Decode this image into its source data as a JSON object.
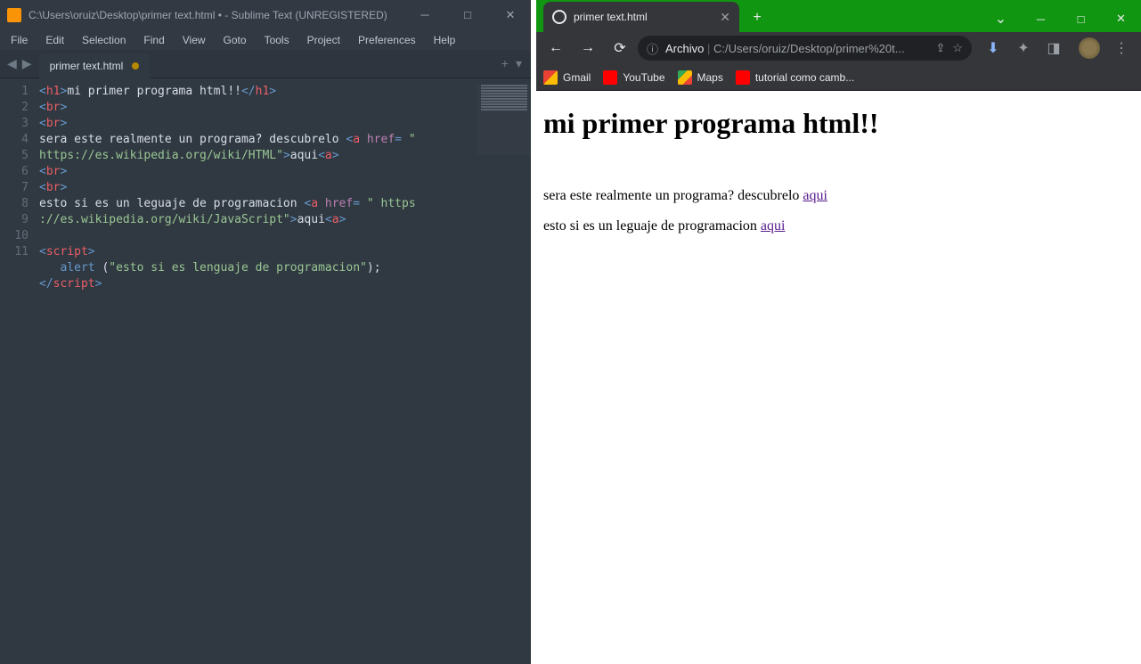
{
  "sublime": {
    "title": "C:\\Users\\oruiz\\Desktop\\primer text.html • - Sublime Text (UNREGISTERED)",
    "menu": [
      "File",
      "Edit",
      "Selection",
      "Find",
      "View",
      "Goto",
      "Tools",
      "Project",
      "Preferences",
      "Help"
    ],
    "tab": "primer text.html",
    "tab_modified": true,
    "line_numbers": [
      "1",
      "2",
      "3",
      "4",
      "",
      "5",
      "6",
      "7",
      "",
      "8",
      "9",
      "10",
      "11"
    ],
    "code": {
      "l1_tag_open": "<h1>",
      "l1_text": "mi primer programa html!!",
      "l1_tag_close": "</h1>",
      "l2": "<br>",
      "l3": "<br>",
      "l4_text": "sera este realmente un programa? descubrelo ",
      "l4_a_open": "<a",
      "l4_href_attr": " href",
      "l4_eq": "= ",
      "l4_href_val": "\" https://es.wikipedia.org/wiki/HTML\"",
      "l4_close": ">",
      "l4b_text": "aqui",
      "l4b_ac": "<a>",
      "l5": "<br>",
      "l6": "<br>",
      "l7_text": "esto si es un leguaje de programacion ",
      "l7_a_open": "<a",
      "l7_href_attr": " href",
      "l7_eq": "= ",
      "l7_href_val": "\" https://es.wikipedia.org/wiki/JavaScript\"",
      "l7_close": ">",
      "l7b_text": "aqui",
      "l7b_ac": "<a>",
      "l9_open": "<script",
      "l9_close": ">",
      "l10_indent": "   ",
      "l10_fn": "alert ",
      "l10_p1": "(",
      "l10_str": "\"esto si es lenguaje de programacion\"",
      "l10_p2": ");",
      "l11_open": "</script",
      "l11_close": ">"
    }
  },
  "chrome": {
    "tab_title": "primer text.html",
    "omnibox_proto": "Archivo",
    "omnibox_path": "C:/Users/oruiz/Desktop/primer%20t...",
    "bookmarks": [
      {
        "label": "Gmail",
        "icon": "bm-gmail"
      },
      {
        "label": "YouTube",
        "icon": "bm-yt"
      },
      {
        "label": "Maps",
        "icon": "bm-maps"
      },
      {
        "label": "tutorial como camb...",
        "icon": "bm-yt"
      }
    ],
    "page": {
      "h1": "mi primer programa html!!",
      "p1_text": "sera este realmente un programa? descubrelo ",
      "p1_link": "aqui",
      "p2_text": "esto si es un leguaje de programacion ",
      "p2_link": "aqui"
    }
  }
}
